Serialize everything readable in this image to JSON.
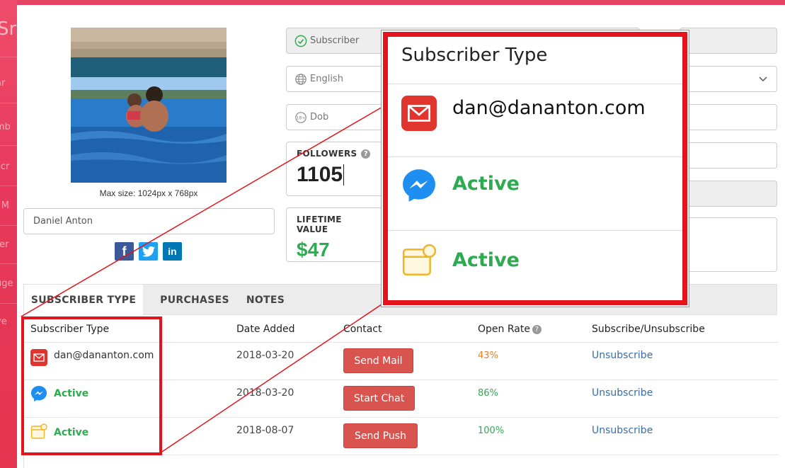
{
  "sidebar": {
    "logo_fragment": "Sr",
    "item_fragments": [
      "ar",
      "mb",
      "scr",
      "l M",
      "ter",
      "uge",
      "ve"
    ]
  },
  "profile": {
    "max_size": "Max size: 1024px x 768px",
    "name": "Daniel Anton"
  },
  "social": {
    "facebook": "f",
    "linkedin": "in"
  },
  "form": {
    "type_value": "Subscriber",
    "language_value": "English",
    "dob_placeholder": "Dob"
  },
  "stats": {
    "followers_label": "FOLLOWERS",
    "followers_value": "1105",
    "lifetime_label": "LIFETIME VALUE",
    "lifetime_value": "$47"
  },
  "tabs": [
    {
      "label": "SUBSCRIBER TYPE",
      "active": true
    },
    {
      "label": "PURCHASES",
      "active": false
    },
    {
      "label": "NOTES",
      "active": false
    }
  ],
  "table": {
    "headers": [
      "Subscriber Type",
      "Date Added",
      "Contact",
      "Open Rate",
      "Subscribe/Unsubscribe"
    ],
    "rows": [
      {
        "type_icon": "email-icon",
        "type_text": "dan@dananton.com",
        "date": "2018-03-20",
        "contact": "Send Mail",
        "open_rate": "43%",
        "action": "Unsubscribe"
      },
      {
        "type_icon": "messenger-icon",
        "type_text": "Active",
        "date": "2018-03-20",
        "contact": "Start Chat",
        "open_rate": "86%",
        "action": "Unsubscribe"
      },
      {
        "type_icon": "push-notification-icon",
        "type_text": "Active",
        "date": "2018-08-07",
        "contact": "Send Push",
        "open_rate": "100%",
        "action": "Unsubscribe"
      }
    ]
  },
  "callout": {
    "title": "Subscriber Type",
    "email": "dan@dananton.com",
    "messenger_status": "Active",
    "push_status": "Active"
  },
  "colors": {
    "brand_pink": "#e8355a",
    "highlight_red": "#e3141b",
    "active_green": "#2dab51",
    "button_red": "#d9534f",
    "link_blue": "#3a6ea5",
    "rate_orange": "#e67e22"
  }
}
